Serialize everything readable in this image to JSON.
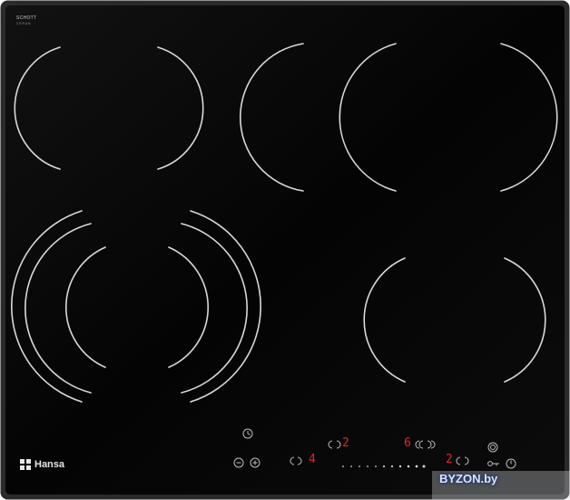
{
  "brand": {
    "glass_maker": "SCHOTT",
    "glass_line": "CERAN",
    "logo_text": "Hansa"
  },
  "display": {
    "zone_left_level": "4",
    "zone_rear_mid_level": "2",
    "zone_rear_right_level": "6",
    "zone_front_right_level": "2"
  },
  "watermark": {
    "text": "BYZON.by"
  },
  "colors": {
    "glass": "#050505",
    "frame": "#2a2a2a",
    "zone_line": "#d9d9d9",
    "display_red": "#e0262a",
    "control_icon": "#bdbdbd"
  },
  "icons": {
    "timer": "clock-icon",
    "minus": "minus-icon",
    "plus": "plus-icon",
    "power": "power-icon",
    "lock": "key-lock-icon",
    "boost": "boost-icon"
  }
}
